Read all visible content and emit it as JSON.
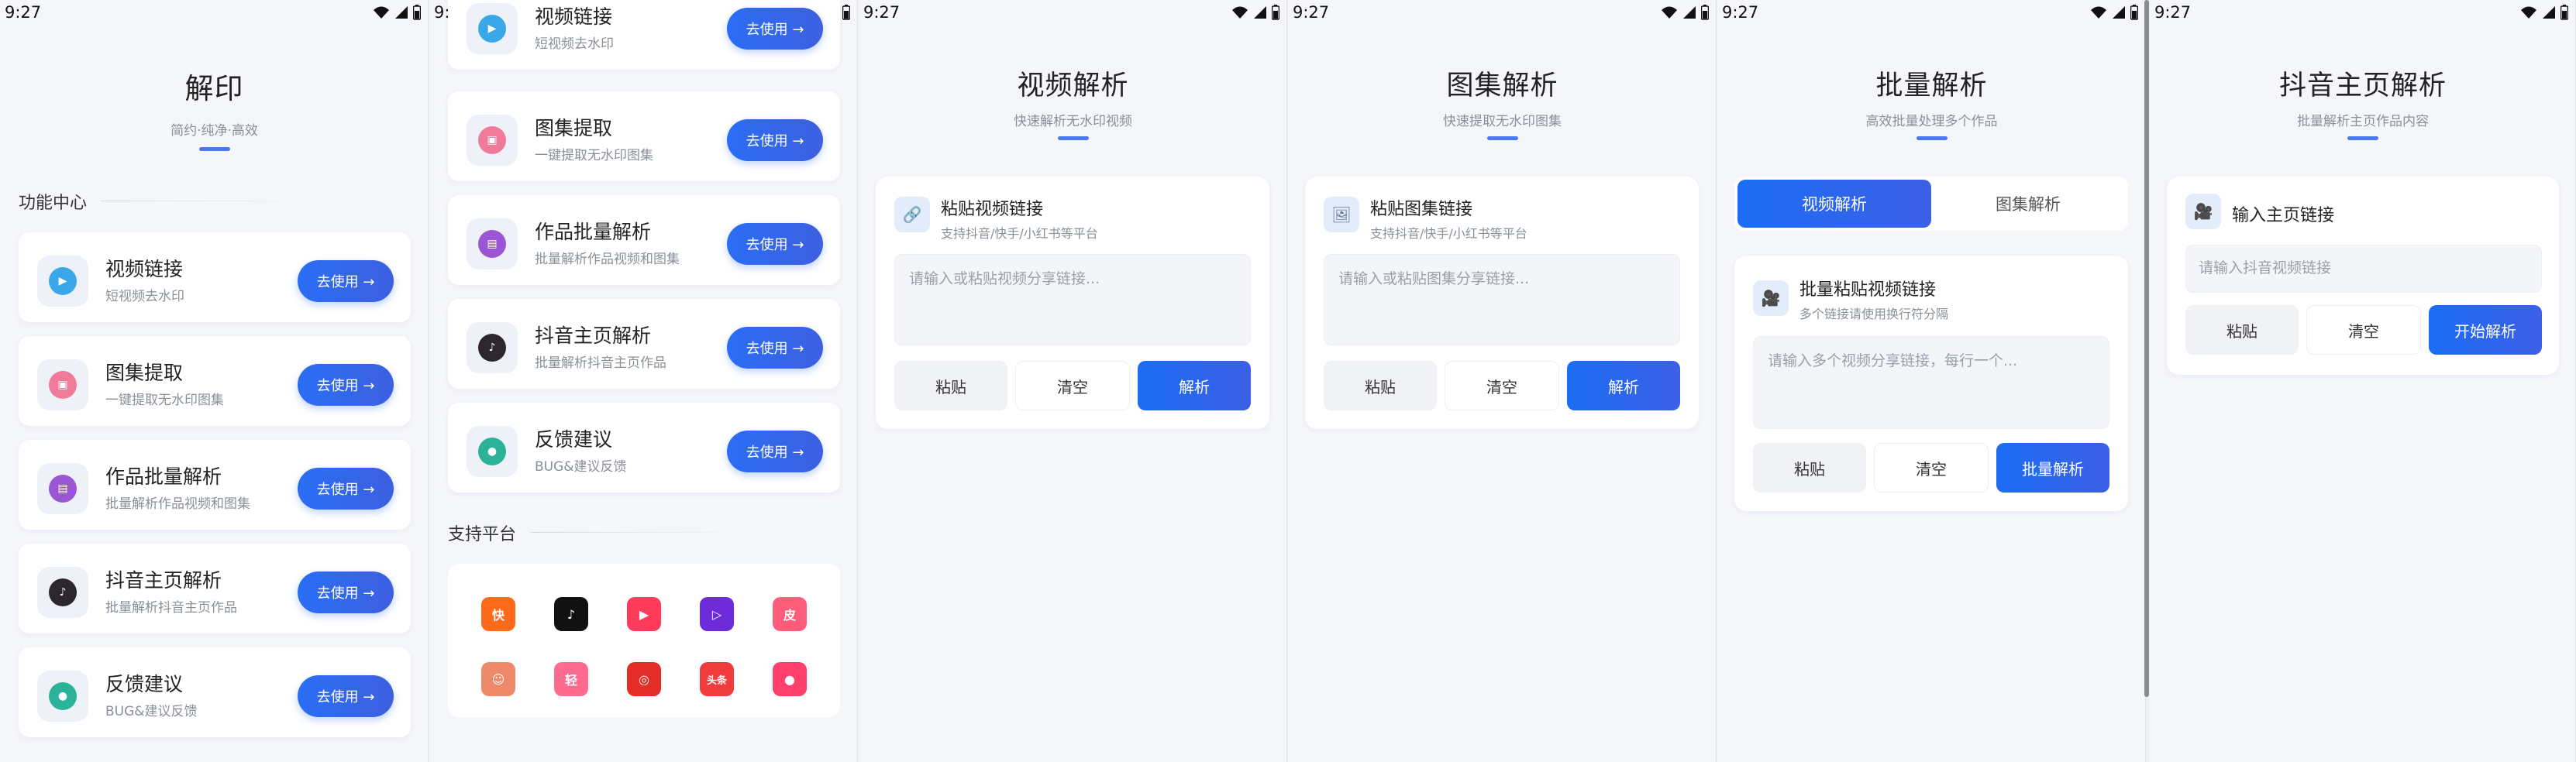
{
  "status": {
    "time": "9:27"
  },
  "home": {
    "title": "解印",
    "subtitle": "简约·纯净·高效",
    "section_features": "功能中心",
    "section_platforms": "支持平台",
    "go_label": "去使用 →",
    "features": [
      {
        "title": "视频链接",
        "desc": "短视频去水印",
        "icon": "play-icon",
        "color": "#3aa8e8"
      },
      {
        "title": "图集提取",
        "desc": "一键提取无水印图集",
        "icon": "image-icon",
        "color": "#f07a9a"
      },
      {
        "title": "作品批量解析",
        "desc": "批量解析作品视频和图集",
        "icon": "batch-icon",
        "color": "#9b56d6"
      },
      {
        "title": "抖音主页解析",
        "desc": "批量解析抖音主页作品",
        "icon": "douyin-icon",
        "color": "#2b2630"
      },
      {
        "title": "反馈建议",
        "desc": "BUG&建议反馈",
        "icon": "chat-icon",
        "color": "#2bb39a"
      }
    ],
    "platforms": [
      {
        "name": "kuaishou-logo",
        "color": "#ff6a1a",
        "glyph": "快"
      },
      {
        "name": "douyin-logo",
        "color": "#111111",
        "glyph": "♪"
      },
      {
        "name": "weishi-logo",
        "color": "#ff3b5c",
        "glyph": "▶"
      },
      {
        "name": "video-logo",
        "color": "#6d2bd9",
        "glyph": "▷"
      },
      {
        "name": "pipixia-logo",
        "color": "#ff5c7a",
        "glyph": "皮"
      },
      {
        "name": "avatar-logo",
        "color": "#ee8a6a",
        "glyph": "☺"
      },
      {
        "name": "lofter-logo",
        "color": "#ff6b8f",
        "glyph": "轻"
      },
      {
        "name": "netease-logo",
        "color": "#e52d27",
        "glyph": "◎"
      },
      {
        "name": "toutiao-logo",
        "color": "#f03c3c",
        "glyph": "头条"
      },
      {
        "name": "xiaohongshu-logo",
        "color": "#ff3f6c",
        "glyph": "●"
      }
    ]
  },
  "video": {
    "title": "视频解析",
    "subtitle": "快速解析无水印视频",
    "card_title": "粘贴视频链接",
    "card_sub": "支持抖音/快手/小红书等平台",
    "placeholder": "请输入或粘贴视频分享链接...",
    "paste": "粘贴",
    "clear": "清空",
    "parse": "解析"
  },
  "gallery": {
    "title": "图集解析",
    "subtitle": "快速提取无水印图集",
    "card_title": "粘贴图集链接",
    "card_sub": "支持抖音/快手/小红书等平台",
    "placeholder": "请输入或粘贴图集分享链接...",
    "paste": "粘贴",
    "clear": "清空",
    "parse": "解析"
  },
  "batch": {
    "title": "批量解析",
    "subtitle": "高效批量处理多个作品",
    "tab_video": "视频解析",
    "tab_gallery": "图集解析",
    "card_title": "批量粘贴视频链接",
    "card_sub": "多个链接请使用换行符分隔",
    "placeholder": "请输入多个视频分享链接，每行一个...",
    "paste": "粘贴",
    "clear": "清空",
    "parse": "批量解析"
  },
  "homepage": {
    "title": "抖音主页解析",
    "subtitle": "批量解析主页作品内容",
    "card_title": "输入主页链接",
    "placeholder": "请输入抖音视频链接",
    "paste": "粘贴",
    "clear": "清空",
    "parse": "开始解析"
  }
}
